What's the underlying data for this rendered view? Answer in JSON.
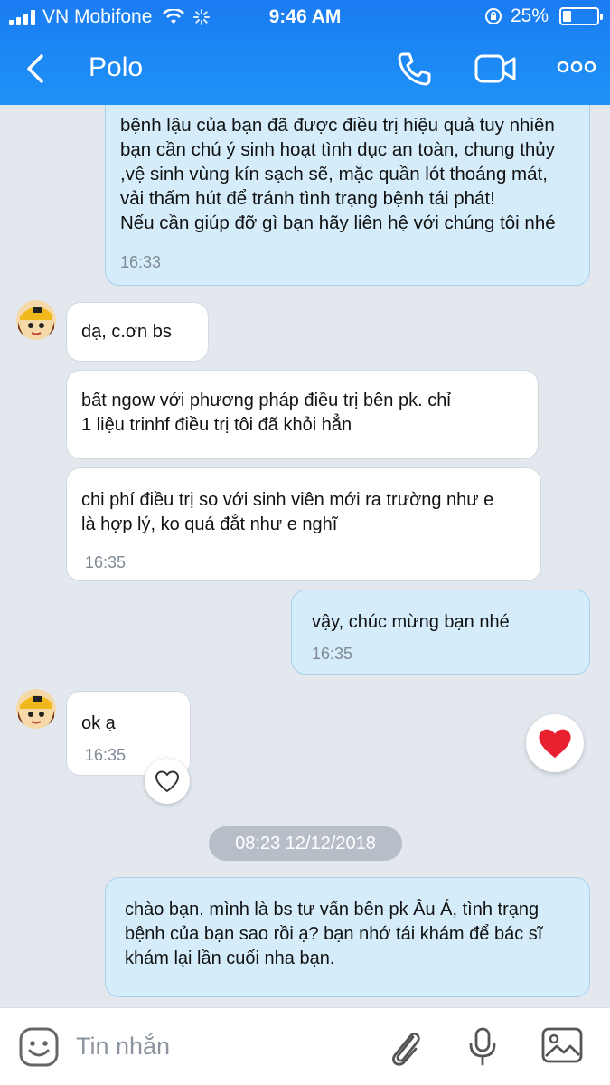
{
  "status_bar": {
    "carrier": "VN Mobifone",
    "time": "9:46 AM",
    "battery": "25%",
    "battery_level": 0.25
  },
  "header": {
    "contact_name": "Polo",
    "icons": [
      "back-arrow-icon",
      "phone-icon",
      "video-camera-icon",
      "more-dots-icon"
    ]
  },
  "messages": [
    {
      "direction": "out",
      "lines": [
        "bệnh lậu của bạn đã được điều trị hiệu quả tuy nhiên",
        "bạn cần chú ý sinh hoạt tình dục an toàn, chung thủy",
        ",vệ sinh vùng kín sạch sẽ, mặc quần lót thoáng mát,",
        "vải thấm hút để tránh tình trạng bệnh tái phát!",
        "Nếu cần giúp đỡ gì bạn hãy liên hệ với chúng tôi nhé"
      ],
      "time": "16:33"
    },
    {
      "direction": "in",
      "lines": [
        "dạ, c.ơn bs"
      ]
    },
    {
      "direction": "in",
      "lines": [
        "bất ngow với phương pháp điều trị bên pk. chỉ",
        "1 liệu trinhf điều trị tôi đã khỏi hẳn"
      ]
    },
    {
      "direction": "in",
      "lines": [
        "chi phí điều trị so với sinh viên mới ra trường như e",
        "là hợp lý, ko quá đắt như e nghĩ"
      ],
      "time": "16:35"
    },
    {
      "direction": "out",
      "lines": [
        "vậy, chúc mừng bạn nhé"
      ],
      "time": "16:35"
    },
    {
      "direction": "in",
      "lines": [
        "ok ạ"
      ],
      "time": "16:35"
    },
    {
      "direction": "out",
      "lines": [
        "chào bạn. mình là bs tư vấn bên pk Âu Á, tình trạng",
        "bệnh của bạn sao rồi ạ? bạn nhớ tái khám để bác sĩ",
        "khám lại lần cuối nha bạn."
      ]
    }
  ],
  "date_separator": "08:23 12/12/2018",
  "input": {
    "placeholder": "Tin nhắn"
  },
  "colors": {
    "header": "#1e88f4",
    "outgoing_bubble": "#d5edfb",
    "incoming_bubble": "#ffffff",
    "chat_background": "#e3e8ef",
    "heart": "#e8202f"
  }
}
